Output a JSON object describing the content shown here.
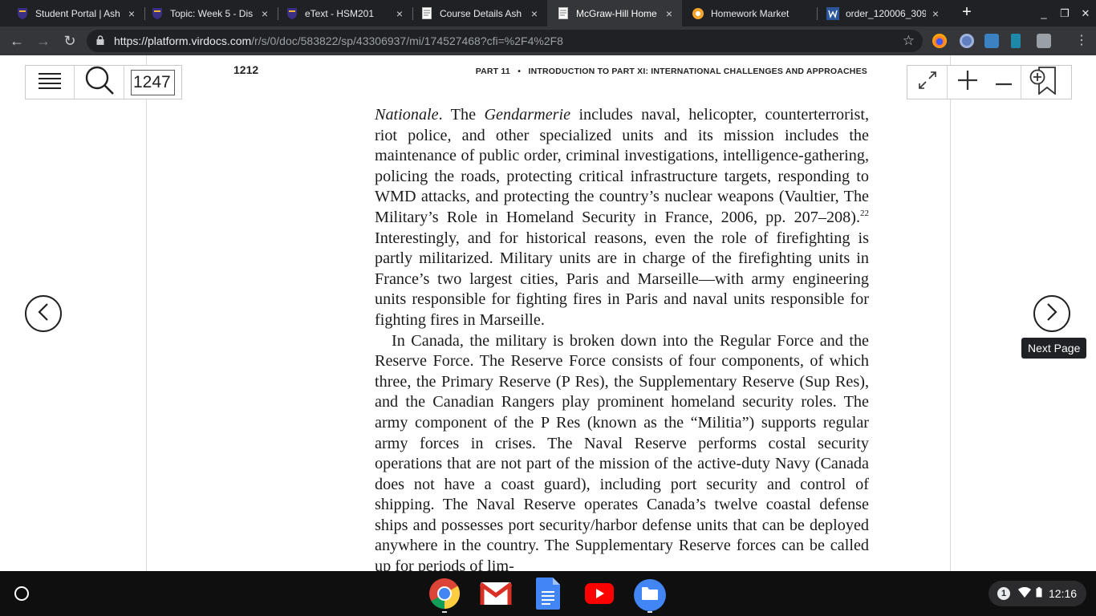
{
  "tabs": [
    {
      "title": "Student Portal | Ash",
      "active": false,
      "favicon": "shield-icon"
    },
    {
      "title": "Topic: Week 5 - Dis",
      "active": false,
      "favicon": "shield-icon"
    },
    {
      "title": "eText - HSM201",
      "active": false,
      "favicon": "shield-icon"
    },
    {
      "title": "Course Details Ash",
      "active": false,
      "favicon": "document-icon"
    },
    {
      "title": "McGraw-Hill Home",
      "active": true,
      "favicon": "document-icon"
    },
    {
      "title": "Homework Market",
      "active": false,
      "favicon": "market-icon"
    },
    {
      "title": "order_120006_309",
      "active": false,
      "favicon": "word-icon"
    }
  ],
  "tab_close": "×",
  "new_tab": "+",
  "address": {
    "host": "https://platform.virdocs.com",
    "path": "/r/s/0/doc/583822/sp/43306937/mi/174527468?cfi=%2F4%2F8"
  },
  "reader": {
    "page_input": "1247",
    "printed_page_number": "1212",
    "running_head": "PART 11   •   INTRODUCTION TO PART XI: INTERNATIONAL CHALLENGES AND APPROACHES",
    "paragraph1": {
      "lead_italic": "Nationale",
      "after_lead": ". The ",
      "italic2": "Gendarmerie",
      "rest": " includes naval, helicopter, counterterror­ist, riot police, and other specialized units and its mission includes the maintenance of public order, criminal investigations, intelligence-gathering, policing the roads, protecting critical infrastructure targets, responding to WMD attacks, and protecting the country’s nuclear weap­ons (Vaultier, The Military’s Role in Homeland Security in France, 2006, pp. 207–208).",
      "footnote": "22",
      "tail": " Interestingly, and for historical reasons, even the role of firefighting is partly militarized. Military units are in charge of the fire­fighting units in France’s two largest cities, Paris and Marseille—with army engineering units responsible for fighting fires in Paris and naval units responsible for fighting fires in Marseille."
    },
    "paragraph2": "In Canada, the military is broken down into the Regular Force and the Reserve Force. The Reserve Force consists of four components, of which three, the Primary Reserve (P Res), the Supplementary Reserve (Sup Res), and the Canadian Rangers play prominent homeland security roles. The army component of the P Res (known as the “Militia”) supports regular army forces in crises. The Naval Reserve performs costal security operations that are not part of the mission of the active-duty Navy (Canada does not have a coast guard), includ­ing port security and control of shipping. The Naval Reserve operates Canada’s twelve coastal defense ships and possesses port security/harbor defense units that can be deployed anywhere in the country. The Supplementary Reserve forces can be called up for periods of lim-",
    "next_tooltip": "Next Page"
  },
  "tray": {
    "notification_count": "1",
    "time": "12:16"
  },
  "colors": {
    "tab_strip": "#202124",
    "toolbar": "#35363a",
    "shelf": "#0f0f10"
  }
}
